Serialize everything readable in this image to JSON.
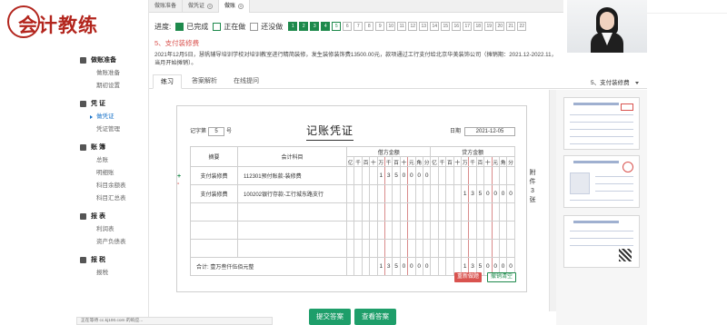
{
  "brand": {
    "logo_text": "会计教练"
  },
  "top_tabs": [
    {
      "label": "做账准备"
    },
    {
      "label": "做凭证"
    },
    {
      "label": "做账"
    }
  ],
  "sidebar": {
    "groups": [
      {
        "label": "做账准备",
        "items": [
          "做账准备",
          "期初设置"
        ]
      },
      {
        "label": "凭 证",
        "items": [
          "做凭证",
          "凭证管理"
        ]
      },
      {
        "label": "账 簿",
        "items": [
          "总账",
          "明细账",
          "科目余额表",
          "科目汇总表"
        ]
      },
      {
        "label": "报 表",
        "items": [
          "利润表",
          "资产负债表"
        ]
      },
      {
        "label": "报 税",
        "items": [
          "报税"
        ]
      }
    ],
    "active_item": "做凭证"
  },
  "progress": {
    "label": "进度:",
    "legend_done": "已完成",
    "legend_doing": "正在做",
    "legend_none": "还没做",
    "steps": [
      "1",
      "2",
      "3",
      "4",
      "5",
      "6",
      "7",
      "8",
      "9",
      "10",
      "11",
      "12",
      "13",
      "14",
      "15",
      "16",
      "17",
      "18",
      "19",
      "20",
      "21",
      "22"
    ],
    "current": "5",
    "colors": {
      "done": "#1e8a4c"
    }
  },
  "question": {
    "title": "5、支付装修费",
    "text": "2021年12月5日，慧帆辅导培训学校对培训教室进行精简装修，发生装修装饰费13500.00元，款项通过工行支付给北京华美装饰公司（摊销期：2021.12-2022.11，当月开始摊销）。"
  },
  "answer_tabs": [
    "练习",
    "答案解析",
    "在线提问"
  ],
  "question_select": "5、支付装修费",
  "voucher": {
    "no_label": "记字第",
    "no_value": "5",
    "no_suffix": "号",
    "title": "记账凭证",
    "date_label": "日期",
    "date_value": "2021-12-05",
    "headers": {
      "summary": "摘要",
      "account": "会计科目",
      "debit": "借方金额",
      "credit": "贷方金额",
      "digits": [
        "亿",
        "千",
        "百",
        "十",
        "万",
        "千",
        "百",
        "十",
        "元",
        "角",
        "分"
      ]
    },
    "rows": [
      {
        "summary": "支付装修费",
        "account": "112301预付账款-装修费",
        "debit": [
          "",
          "",
          "",
          "",
          "1",
          "3",
          "5",
          "0",
          "0",
          "0",
          "0"
        ],
        "credit": [
          "",
          "",
          "",
          "",
          "",
          "",
          "",
          "",
          "",
          "",
          ""
        ]
      },
      {
        "summary": "支付装修费",
        "account": "100202银行存款-工行城东路支行",
        "debit": [
          "",
          "",
          "",
          "",
          "",
          "",
          "",
          "",
          "",
          "",
          ""
        ],
        "credit": [
          "",
          "",
          "",
          "",
          "1",
          "3",
          "5",
          "0",
          "0",
          "0",
          "0"
        ]
      }
    ],
    "total_label": "合计: 壹万叁仟伍佰元整",
    "total_debit": [
      "",
      "",
      "",
      "",
      "1",
      "3",
      "5",
      "0",
      "0",
      "0",
      "0"
    ],
    "total_credit": [
      "",
      "",
      "",
      "",
      "1",
      "3",
      "5",
      "0",
      "0",
      "0",
      "0"
    ],
    "attachment_label": "附件",
    "attachment_count": "3",
    "attachment_unit": "张",
    "plus": "+",
    "minus": "-",
    "redo_label": "重新做题",
    "clear_label": "撤销清空"
  },
  "buttons": {
    "submit": "提交答案",
    "view": "查看答案"
  },
  "status_bar": "正在等待 cc.kj100.com 的响应..."
}
